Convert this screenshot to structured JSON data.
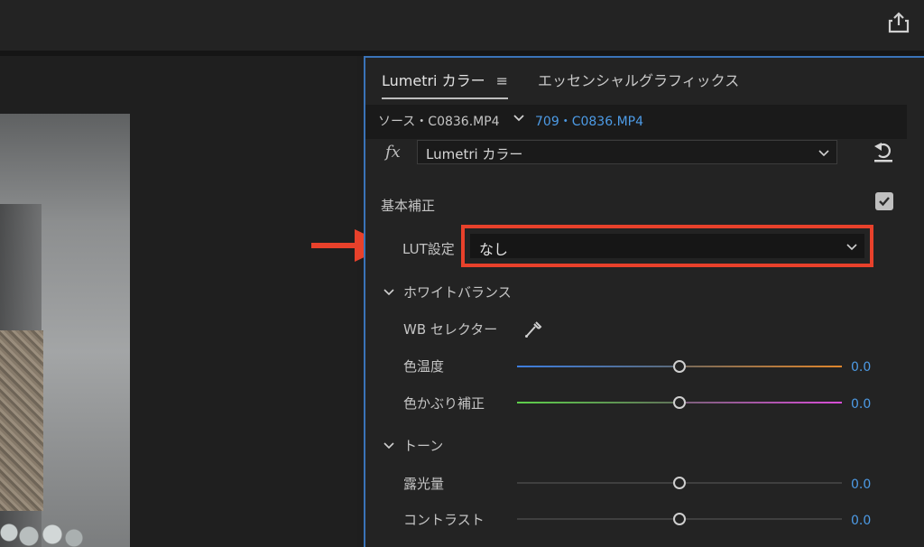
{
  "panel": {
    "tabs": [
      {
        "label": "Lumetri カラー",
        "menu_glyph": "≡"
      },
      {
        "label": "エッセンシャルグラフィックス"
      }
    ],
    "clip": {
      "source": "ソース・C0836.MP4",
      "target": "709・C0836.MP4"
    },
    "effect": {
      "fx_label": "fx",
      "selected": "Lumetri カラー"
    },
    "basic_correction": {
      "title": "基本補正",
      "enabled": true,
      "lut_label": "LUT設定",
      "lut_value": "なし"
    },
    "white_balance": {
      "title": "ホワイトバランス",
      "wb_selector_label": "WB セレクター",
      "temperature": {
        "label": "色温度",
        "value": "0.0",
        "level": 0.5
      },
      "tint": {
        "label": "色かぶり補正",
        "value": "0.0",
        "level": 0.5
      }
    },
    "tone": {
      "title": "トーン",
      "exposure": {
        "label": "露光量",
        "value": "0.0",
        "level": 0.5
      },
      "contrast": {
        "label": "コントラスト",
        "value": "0.0",
        "level": 0.5
      }
    }
  },
  "icons": {
    "share": "share-icon",
    "reset": "reset-icon",
    "eyedropper": "eyedropper-icon",
    "arrow": "arrow-right-icon"
  },
  "colors": {
    "accent_blue": "#4d9be6",
    "highlight_red": "#e8412b",
    "panel_border": "#3a73b8"
  }
}
